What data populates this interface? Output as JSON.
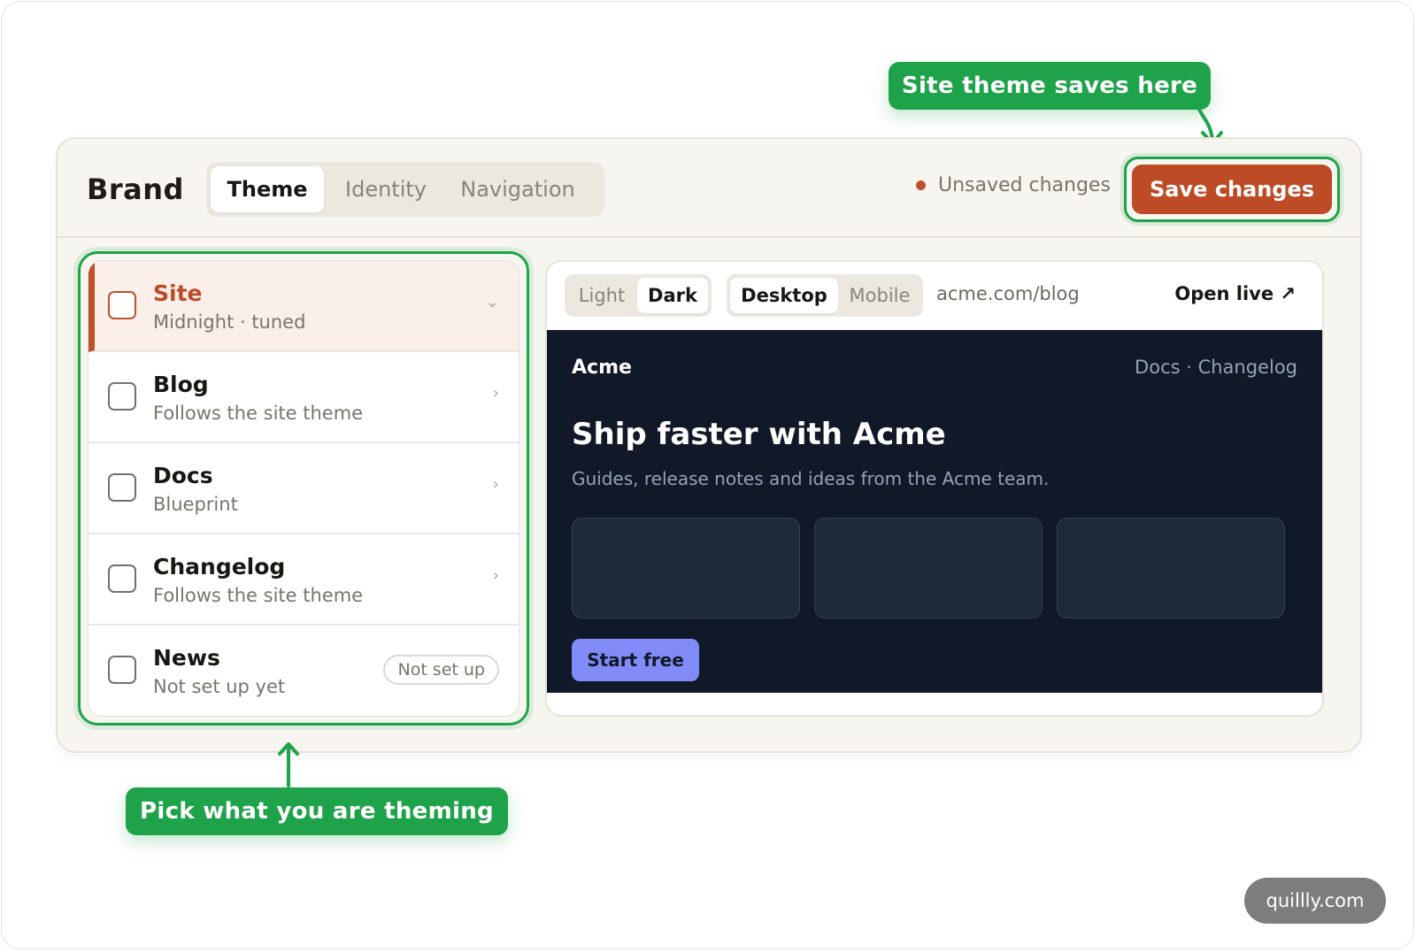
{
  "header": {
    "brand": "Brand",
    "tabs": [
      {
        "label": "Theme",
        "active": true
      },
      {
        "label": "Identity",
        "active": false
      },
      {
        "label": "Navigation",
        "active": false
      }
    ],
    "status": "Unsaved changes",
    "save_label": "Save changes"
  },
  "list": {
    "items": [
      {
        "title": "Site",
        "subtitle": "Midnight · tuned",
        "selected": true,
        "chevron": "⌄",
        "icon": "chevron-down-icon"
      },
      {
        "title": "Blog",
        "subtitle": "Follows the site theme",
        "selected": false,
        "chevron": "›",
        "icon": "chevron-right-icon"
      },
      {
        "title": "Docs",
        "subtitle": "Blueprint",
        "selected": false,
        "chevron": "›",
        "icon": "chevron-right-icon"
      },
      {
        "title": "Changelog",
        "subtitle": "Follows the site theme",
        "selected": false,
        "chevron": "›",
        "icon": "chevron-right-icon"
      },
      {
        "title": "News",
        "subtitle": "Not set up yet",
        "selected": false,
        "badge": "Not set up"
      }
    ]
  },
  "preview": {
    "mode": {
      "options": [
        "Light",
        "Dark"
      ],
      "selected": "Dark"
    },
    "device": {
      "options": [
        "Desktop",
        "Mobile"
      ],
      "selected": "Desktop"
    },
    "url": "acme.com/blog",
    "open_live": "Open live ↗",
    "site": {
      "logo": "Acme",
      "nav": "Docs · Changelog",
      "headline": "Ship faster with Acme",
      "lead": "Guides, release notes and ideas from the Acme team.",
      "cta": "Start free"
    }
  },
  "callouts": {
    "save": "Site theme saves here",
    "pick": "Pick what you are theming"
  },
  "watermark": "quillly.com",
  "colors": {
    "accent": "#bd4b25",
    "callout": "#1fa34a",
    "site_bg": "#111828",
    "site_cta": "#818cf8"
  }
}
